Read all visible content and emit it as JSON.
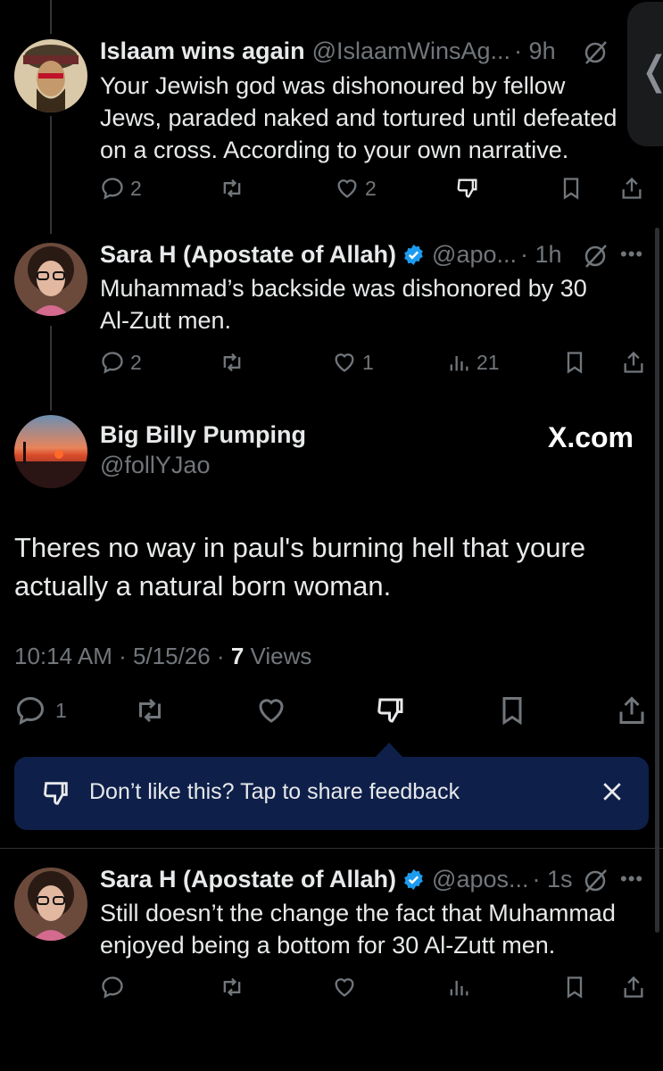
{
  "post1": {
    "name": "Islaam wins again",
    "handle": "@IslaamWinsAg...",
    "time": "· 9h",
    "lines": [
      "Your Jewish god was dishonoured by fellow",
      "Jews, paraded naked and tortured until defeated",
      "on a cross. According to your own narrative."
    ],
    "replies": "2",
    "likes": "2"
  },
  "post2": {
    "name": "Sara H (Apostate of Allah)",
    "handle": "@apo...",
    "time": "· 1h",
    "lines": [
      "Muhammad’s backside was dishonored by 30",
      "Al-Zutt men."
    ],
    "replies": "2",
    "likes": "1",
    "views": "21"
  },
  "main": {
    "name": "Big Billy Pumping",
    "handle": "@follYJao",
    "watermark": "X.com",
    "lines": [
      "Theres no way in paul's burning hell that youre",
      "actually a natural born woman."
    ],
    "timestamp": "10:14 AM · 5/15/26 ·",
    "views_count": "7",
    "views_label": "Views",
    "replies": "1"
  },
  "feedback": {
    "text": "Don’t like this? Tap to share feedback"
  },
  "post3": {
    "name": "Sara H (Apostate of Allah)",
    "handle": "@apos...",
    "time": "· 1s",
    "lines": [
      "Still doesn’t the change the fact that Muhammad",
      "enjoyed being a bottom for 30 Al-Zutt men."
    ]
  },
  "side_handle_glyph": "❬",
  "colors": {
    "background": "#000000",
    "text": "#e7e9ea",
    "secondary": "#71767b",
    "verified": "#1d9bf0",
    "feedback_bg": "#0e1f4a"
  }
}
